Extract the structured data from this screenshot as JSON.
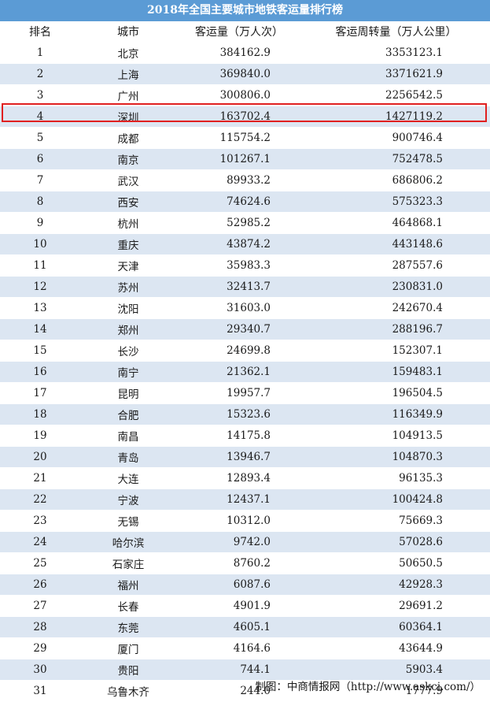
{
  "chart_data": {
    "type": "table",
    "title": "2018年全国主要城市地铁客运量排行榜",
    "columns": [
      "排名",
      "城市",
      "客运量（万人次）",
      "客运周转量（万人公里）"
    ],
    "rows": [
      [
        "1",
        "北京",
        "384162.9",
        "3353123.1"
      ],
      [
        "2",
        "上海",
        "369840.0",
        "3371621.9"
      ],
      [
        "3",
        "广州",
        "300806.0",
        "2256542.5"
      ],
      [
        "4",
        "深圳",
        "163702.4",
        "1427119.2"
      ],
      [
        "5",
        "成都",
        "115754.2",
        "900746.4"
      ],
      [
        "6",
        "南京",
        "101267.1",
        "752478.5"
      ],
      [
        "7",
        "武汉",
        "89933.2",
        "686806.2"
      ],
      [
        "8",
        "西安",
        "74624.6",
        "575323.3"
      ],
      [
        "9",
        "杭州",
        "52985.2",
        "464868.1"
      ],
      [
        "10",
        "重庆",
        "43874.2",
        "443148.6"
      ],
      [
        "11",
        "天津",
        "35983.3",
        "287557.6"
      ],
      [
        "12",
        "苏州",
        "32413.7",
        "230831.0"
      ],
      [
        "13",
        "沈阳",
        "31603.0",
        "242670.4"
      ],
      [
        "14",
        "郑州",
        "29340.7",
        "288196.7"
      ],
      [
        "15",
        "长沙",
        "24699.8",
        "152307.1"
      ],
      [
        "16",
        "南宁",
        "21362.1",
        "159483.1"
      ],
      [
        "17",
        "昆明",
        "19957.7",
        "196504.5"
      ],
      [
        "18",
        "合肥",
        "15323.6",
        "116349.9"
      ],
      [
        "19",
        "南昌",
        "14175.8",
        "104913.5"
      ],
      [
        "20",
        "青岛",
        "13946.7",
        "104870.3"
      ],
      [
        "21",
        "大连",
        "12893.4",
        "96135.3"
      ],
      [
        "22",
        "宁波",
        "12437.1",
        "100424.8"
      ],
      [
        "23",
        "无锡",
        "10312.0",
        "75669.3"
      ],
      [
        "24",
        "哈尔滨",
        "9742.0",
        "57028.6"
      ],
      [
        "25",
        "石家庄",
        "8760.2",
        "50650.5"
      ],
      [
        "26",
        "福州",
        "6087.6",
        "42928.3"
      ],
      [
        "27",
        "长春",
        "4901.9",
        "29691.2"
      ],
      [
        "28",
        "东莞",
        "4605.1",
        "60364.1"
      ],
      [
        "29",
        "厦门",
        "4164.6",
        "43644.9"
      ],
      [
        "30",
        "贵阳",
        "744.1",
        "5903.4"
      ],
      [
        "31",
        "乌鲁木齐",
        "244.0",
        "1777.9"
      ]
    ],
    "highlighted_row": "4",
    "source": "制图：中商情报网（http://www.askci.com/）"
  },
  "colors": {
    "title_bg": "#5b9bd5",
    "stripe": "#dce6f2",
    "highlight": "#e02020"
  }
}
